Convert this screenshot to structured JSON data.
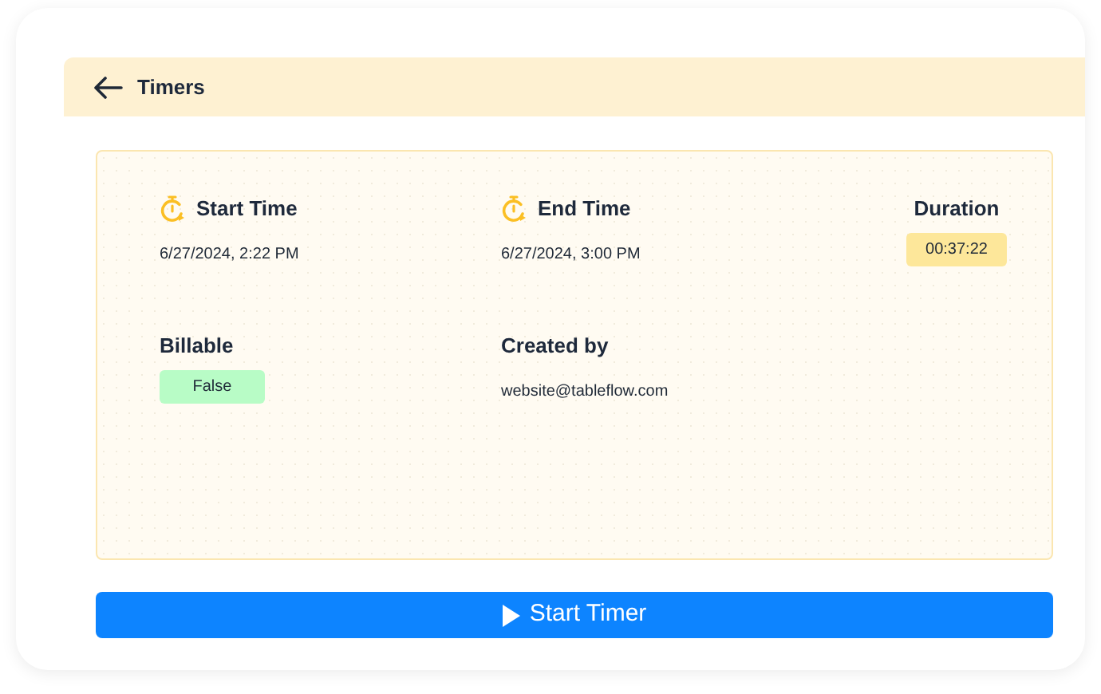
{
  "header": {
    "title": "Timers"
  },
  "fields": [
    {
      "label": "Start Time",
      "value": "6/27/2024, 2:22 PM",
      "kind": "timestamp"
    },
    {
      "label": "End Time",
      "value": "6/27/2024, 3:00 PM",
      "kind": "timestamp"
    },
    {
      "label": "Duration",
      "value": "00:37:22",
      "kind": "badge",
      "color": "#fde79a"
    },
    {
      "label": "Billable",
      "value": "False",
      "kind": "badge",
      "color": "#b8fcc6"
    },
    {
      "label": "Created by",
      "value": "website@tableflow.com",
      "kind": "text"
    }
  ],
  "action_button": {
    "label": "Start Timer"
  }
}
